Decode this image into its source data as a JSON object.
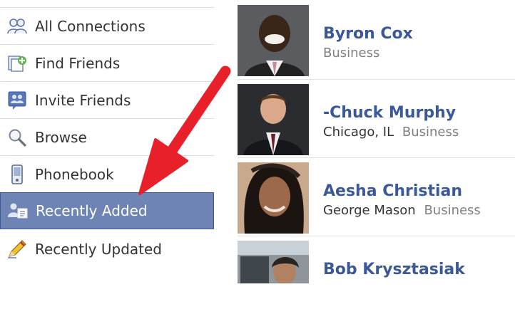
{
  "sidebar": {
    "items": [
      {
        "label": "All Connections",
        "icon": "two-people-icon"
      },
      {
        "label": "Find Friends",
        "icon": "find-friends-icon"
      },
      {
        "label": "Invite Friends",
        "icon": "invite-friends-icon"
      },
      {
        "label": "Browse",
        "icon": "magnifier-icon"
      },
      {
        "label": "Phonebook",
        "icon": "phone-icon"
      },
      {
        "label": "Recently Added",
        "icon": "add-person-icon",
        "selected": true
      },
      {
        "label": "Recently Updated",
        "icon": "pencil-icon"
      }
    ]
  },
  "friends": [
    {
      "name": "Byron Cox",
      "location": "",
      "category": "Business"
    },
    {
      "name": "-Chuck Murphy",
      "location": "Chicago, IL",
      "category": "Business"
    },
    {
      "name": "Aesha Christian",
      "location": "George Mason",
      "category": "Business"
    },
    {
      "name": "Bob Krysztasiak",
      "location": "",
      "category": ""
    }
  ],
  "colors": {
    "link_blue": "#3b5998",
    "selected_bg": "#6d84b4",
    "annotation_arrow": "#e8202a"
  }
}
